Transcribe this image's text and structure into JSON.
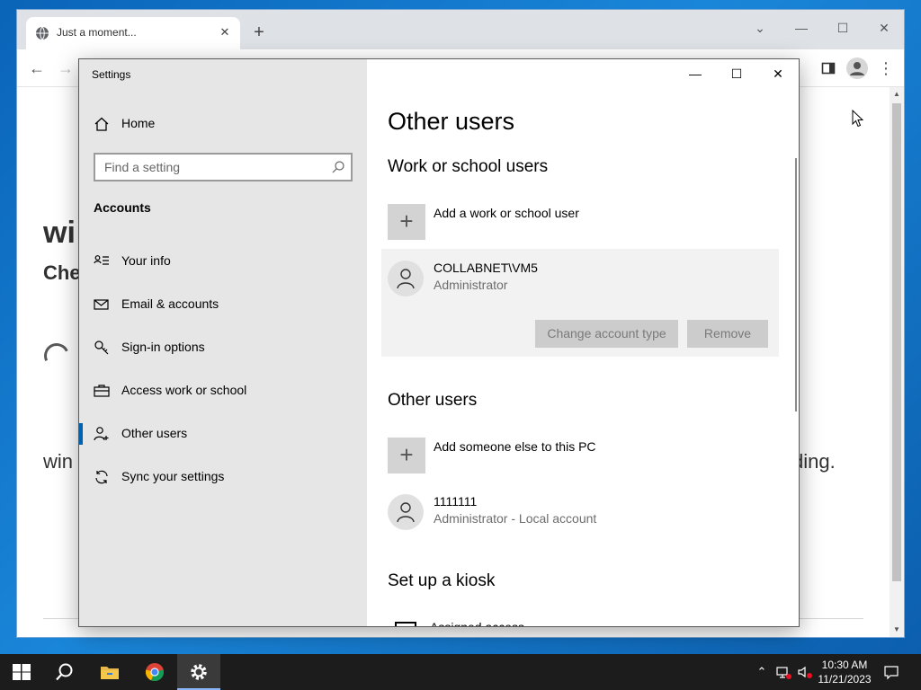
{
  "browser": {
    "tab_title": "Just a moment...",
    "background": {
      "heading_fragment": "wi",
      "subheading_fragment": "Che",
      "line_left_fragment": "win",
      "line_right_fragment": "ding."
    }
  },
  "settings": {
    "window_title": "Settings",
    "nav": {
      "home_label": "Home",
      "search_placeholder": "Find a setting",
      "section_label": "Accounts",
      "items": [
        {
          "label": "Your info",
          "icon": "person-card-icon"
        },
        {
          "label": "Email & accounts",
          "icon": "envelope-icon"
        },
        {
          "label": "Sign-in options",
          "icon": "key-icon"
        },
        {
          "label": "Access work or school",
          "icon": "briefcase-icon"
        },
        {
          "label": "Other users",
          "icon": "person-add-icon",
          "active": true
        },
        {
          "label": "Sync your settings",
          "icon": "sync-icon"
        }
      ]
    },
    "page_title": "Other users",
    "work_section": {
      "heading": "Work or school users",
      "add_label": "Add a work or school user",
      "user": {
        "name": "COLLABNET\\VM5",
        "role": "Administrator",
        "change_button": "Change account type",
        "remove_button": "Remove"
      }
    },
    "other_section": {
      "heading": "Other users",
      "add_label": "Add someone else to this PC",
      "user": {
        "name": "1111111",
        "role": "Administrator - Local account"
      }
    },
    "kiosk_section": {
      "heading": "Set up a kiosk",
      "item_label": "Assigned access"
    }
  },
  "taskbar": {
    "time": "10:30 AM",
    "date": "11/21/2023",
    "accent": "#8ab4f8"
  },
  "colors": {
    "active_indicator": "#0063b1",
    "nav_background": "#e6e6e6",
    "disabled_button": "#cccccc"
  }
}
